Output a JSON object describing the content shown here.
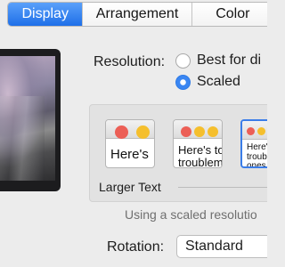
{
  "tabs": [
    {
      "label": "Display",
      "active": true
    },
    {
      "label": "Arrangement",
      "active": false
    },
    {
      "label": "Color",
      "active": false
    }
  ],
  "resolution": {
    "label": "Resolution:",
    "options": [
      {
        "label": "Best for di",
        "selected": false
      },
      {
        "label": "Scaled",
        "selected": true
      }
    ]
  },
  "scaled": {
    "options": [
      {
        "lines": [
          "Here's"
        ]
      },
      {
        "lines": [
          "Here's to",
          "troublem"
        ]
      },
      {
        "lines": [
          "Here'",
          "troub",
          "ones"
        ],
        "selected": true
      }
    ],
    "larger_text_label": "Larger Text",
    "note": "Using a scaled resolutio"
  },
  "rotation": {
    "label": "Rotation:",
    "value": "Standard"
  },
  "colors": {
    "accent": "#2f7be6",
    "background": "#ececec",
    "red_dot": "#ec5f56",
    "yellow_dot": "#f5bf2d"
  }
}
